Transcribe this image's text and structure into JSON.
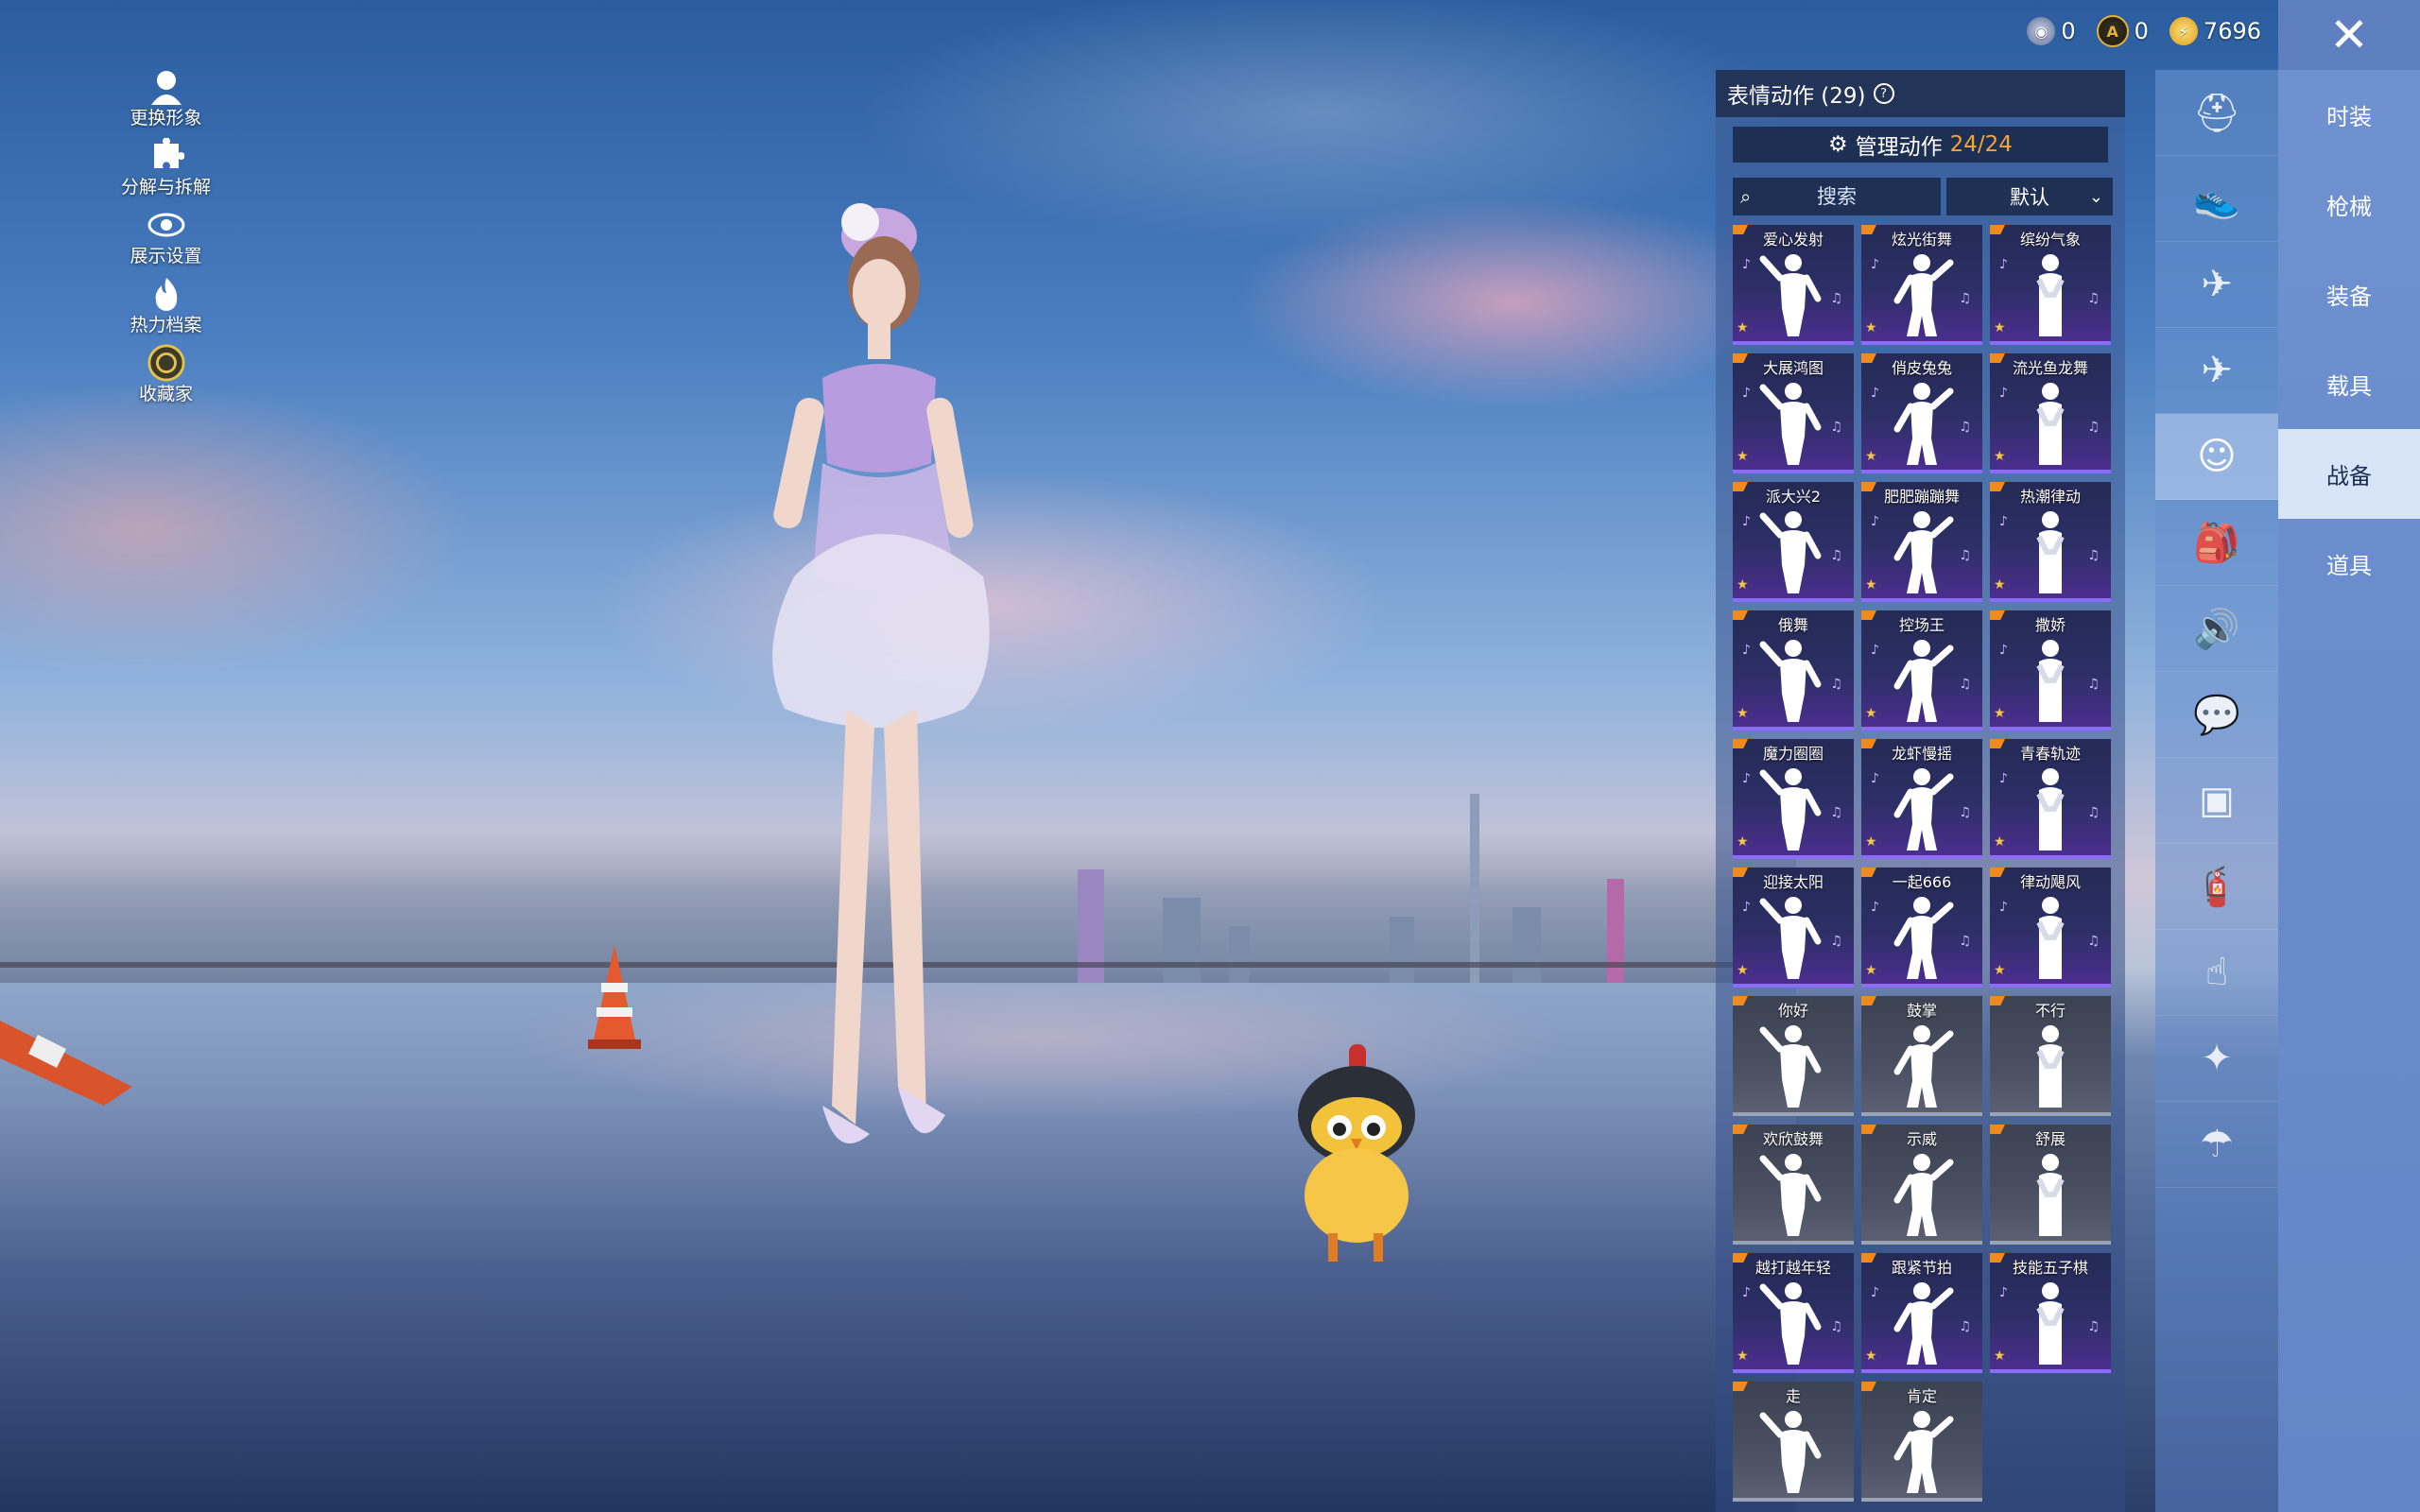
{
  "left_menu": [
    {
      "label": "更换形象",
      "icon": "avatar-icon"
    },
    {
      "label": "分解与拆解",
      "icon": "puzzle-icon"
    },
    {
      "label": "展示设置",
      "icon": "eye-icon"
    },
    {
      "label": "热力档案",
      "icon": "flame-icon"
    },
    {
      "label": "收藏家",
      "icon": "collector-badge-icon"
    }
  ],
  "currency": [
    {
      "icon": "silver-coin-icon",
      "value": "0",
      "color": "#9aa6c8"
    },
    {
      "icon": "gold-coin-icon",
      "value": "0",
      "color": "#e0b23a"
    },
    {
      "icon": "lightning-coin-icon",
      "value": "7696",
      "color": "#f4c63a"
    }
  ],
  "emote_panel": {
    "title": "表情动作 (29)",
    "manage_label": "管理动作",
    "manage_count": "24/24",
    "search_placeholder": "搜索",
    "sort_label": "默认",
    "accent_purple": "#8c6bff",
    "accent_orange": "#f08a1c"
  },
  "emotes": [
    {
      "name": "爱心发射",
      "rarity": "purple"
    },
    {
      "name": "炫光街舞",
      "rarity": "purple"
    },
    {
      "name": "缤纷气象",
      "rarity": "purple"
    },
    {
      "name": "大展鸿图",
      "rarity": "purple"
    },
    {
      "name": "俏皮兔兔",
      "rarity": "purple"
    },
    {
      "name": "流光鱼龙舞",
      "rarity": "purple"
    },
    {
      "name": "派大兴2",
      "rarity": "purple"
    },
    {
      "name": "肥肥蹦蹦舞",
      "rarity": "purple"
    },
    {
      "name": "热潮律动",
      "rarity": "purple"
    },
    {
      "name": "俄舞",
      "rarity": "purple"
    },
    {
      "name": "控场王",
      "rarity": "purple"
    },
    {
      "name": "撒娇",
      "rarity": "purple"
    },
    {
      "name": "魔力圈圈",
      "rarity": "purple"
    },
    {
      "name": "龙虾慢摇",
      "rarity": "purple"
    },
    {
      "name": "青春轨迹",
      "rarity": "purple"
    },
    {
      "name": "迎接太阳",
      "rarity": "purple"
    },
    {
      "name": "一起666",
      "rarity": "purple"
    },
    {
      "name": "律动飓风",
      "rarity": "purple"
    },
    {
      "name": "你好",
      "rarity": "white"
    },
    {
      "name": "鼓掌",
      "rarity": "white"
    },
    {
      "name": "不行",
      "rarity": "white"
    },
    {
      "name": "欢欣鼓舞",
      "rarity": "white"
    },
    {
      "name": "示威",
      "rarity": "white"
    },
    {
      "name": "舒展",
      "rarity": "white"
    },
    {
      "name": "越打越年轻",
      "rarity": "purple"
    },
    {
      "name": "跟紧节拍",
      "rarity": "purple"
    },
    {
      "name": "技能五子棋",
      "rarity": "purple"
    },
    {
      "name": "走",
      "rarity": "white"
    },
    {
      "name": "肯定",
      "rarity": "white"
    }
  ],
  "icon_rail": [
    {
      "icon": "helmet-icon"
    },
    {
      "icon": "shoe-icon"
    },
    {
      "icon": "drone-icon"
    },
    {
      "icon": "plane-icon"
    },
    {
      "icon": "emote-face-icon",
      "active": true
    },
    {
      "icon": "backpack-icon"
    },
    {
      "icon": "speaker-icon"
    },
    {
      "icon": "chat-icon"
    },
    {
      "icon": "gallery-icon"
    },
    {
      "icon": "spray-icon"
    },
    {
      "icon": "hand-tap-icon"
    },
    {
      "icon": "magic-wand-icon"
    },
    {
      "icon": "parachute-icon"
    }
  ],
  "categories": [
    {
      "label": "时装"
    },
    {
      "label": "枪械"
    },
    {
      "label": "装备"
    },
    {
      "label": "载具"
    },
    {
      "label": "战备",
      "active": true
    },
    {
      "label": "道具"
    }
  ],
  "close_label": "✕"
}
